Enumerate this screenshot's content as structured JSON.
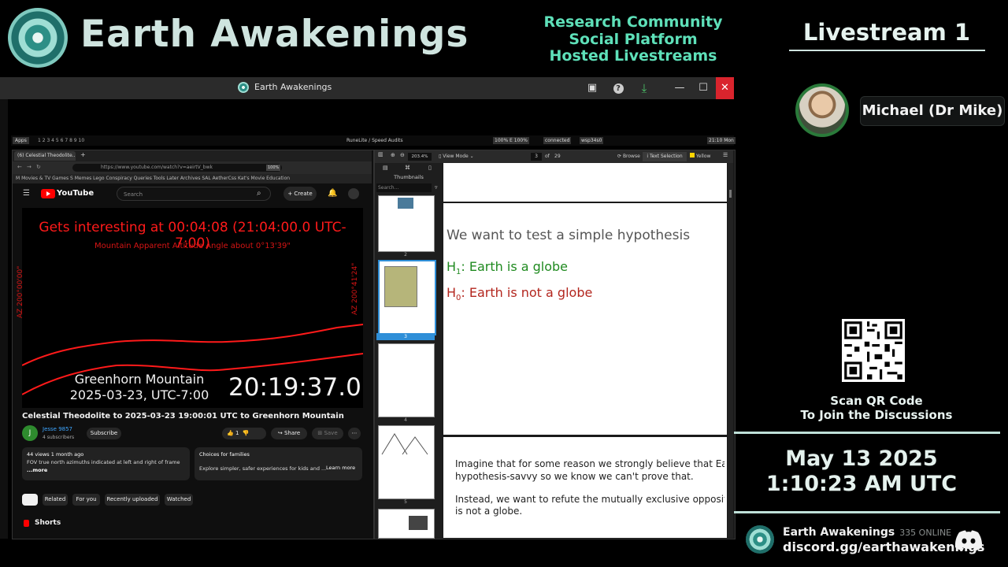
{
  "brand": {
    "name": "Earth Awakenings"
  },
  "tagline": [
    "Research Community",
    "Social Platform",
    "Hosted Livestreams"
  ],
  "livestream": {
    "title": "Livestream 1"
  },
  "host": {
    "name": "Michael (Dr Mike)"
  },
  "qr": {
    "line1": "Scan QR Code",
    "line2": "To Join the Discussions"
  },
  "datetime": {
    "date": "May 13 2025",
    "time": "1:10:23 AM UTC"
  },
  "discord": {
    "server": "Earth Awakenings",
    "online": "335 ONLINE",
    "url": "discord.gg/earthawakenings"
  },
  "window": {
    "title": "Earth Awakenings",
    "close": "✕",
    "minimize": "—",
    "maximize": "☐",
    "help": "?",
    "download": "⤓",
    "cast": "▣"
  },
  "desktop": {
    "apps": "Apps",
    "center": "RuneLite / Speed Audits",
    "connected": "connected",
    "net": "wsp34s0",
    "clock": "21:10 Mon",
    "battery": "100% E 100%",
    "workspaces": "1  2  3  4  5  6  7  8  9  10"
  },
  "browser": {
    "tab": "(6) Celestial Theodolite...",
    "url": "https://www.youtube.com/watch?v=aeirtV_bwk",
    "zoom": "100%",
    "bookmarks": "M   Movies & TV   Games   S   Memes   Lego   Conspiracy Queries   Tools   Later   Archives   SAL   AetherCss   Kat's Movie Education",
    "youtube": {
      "logo": "YouTube",
      "search_placeholder": "Search",
      "create": "+ Create"
    },
    "video": {
      "title": "Gets interesting at 00:04:08 (21:04:00.0 UTC-7:00)",
      "subtitle": "Mountain Apparent Altitude Angle about 0°13'39\"",
      "az_left": "AZ 200°00'00\"",
      "az_right": "AZ 200°41'24\"",
      "place": "Greenhorn Mountain",
      "date": "2025-03-23, UTC-7:00",
      "clock": "20:19:37.0"
    },
    "video_name": "Celestial Theodolite to 2025-03-23 19:00:01 UTC to Greenhorn Mountain",
    "channel": {
      "initial": "J",
      "name": "Jesse 9857",
      "subs": "4 subscribers",
      "subscribe": "Subscribe"
    },
    "actions": {
      "like": "1",
      "share": "Share",
      "save": "Save",
      "more": "⋯"
    },
    "description": {
      "stats": "44 views  1 month ago",
      "text": "FOV true north azimuths indicated at left and right of frame",
      "more": "...more"
    },
    "families": {
      "title": "Choices for families",
      "text": "Explore simpler, safer experiences for kids and ...",
      "learn": "Learn more"
    },
    "chips": [
      "",
      "Related",
      "For you",
      "Recently uploaded",
      "Watched"
    ],
    "shorts": "Shorts"
  },
  "pdf": {
    "view_mode": "View Mode",
    "zoom": "203.4%",
    "page": "3",
    "of": "of",
    "pages": "29",
    "browse": "Browse",
    "text_selection": "Text Selection",
    "highlight": "Yellow",
    "thumbnails_title": "Thumbnails",
    "thumb_search": "Search...",
    "thumb_numbers": [
      "2",
      "3",
      "4",
      "5"
    ],
    "heading": "We want to test a simple hypothesis",
    "h1_label": "H",
    "h1_sub": "1",
    "h1_text": ": Earth is a globe",
    "h0_label": "H",
    "h0_sub": "0",
    "h0_text": ": Earth is not a globe",
    "para1_a": "Imagine that for some reason we strongly believe that Earth is a",
    "para1_b": "hypothesis-savvy so we know we can't prove that.",
    "para2_a": "Instead, we want to refute the mutually exclusive opposite null h",
    "para2_b": "is not a globe."
  }
}
